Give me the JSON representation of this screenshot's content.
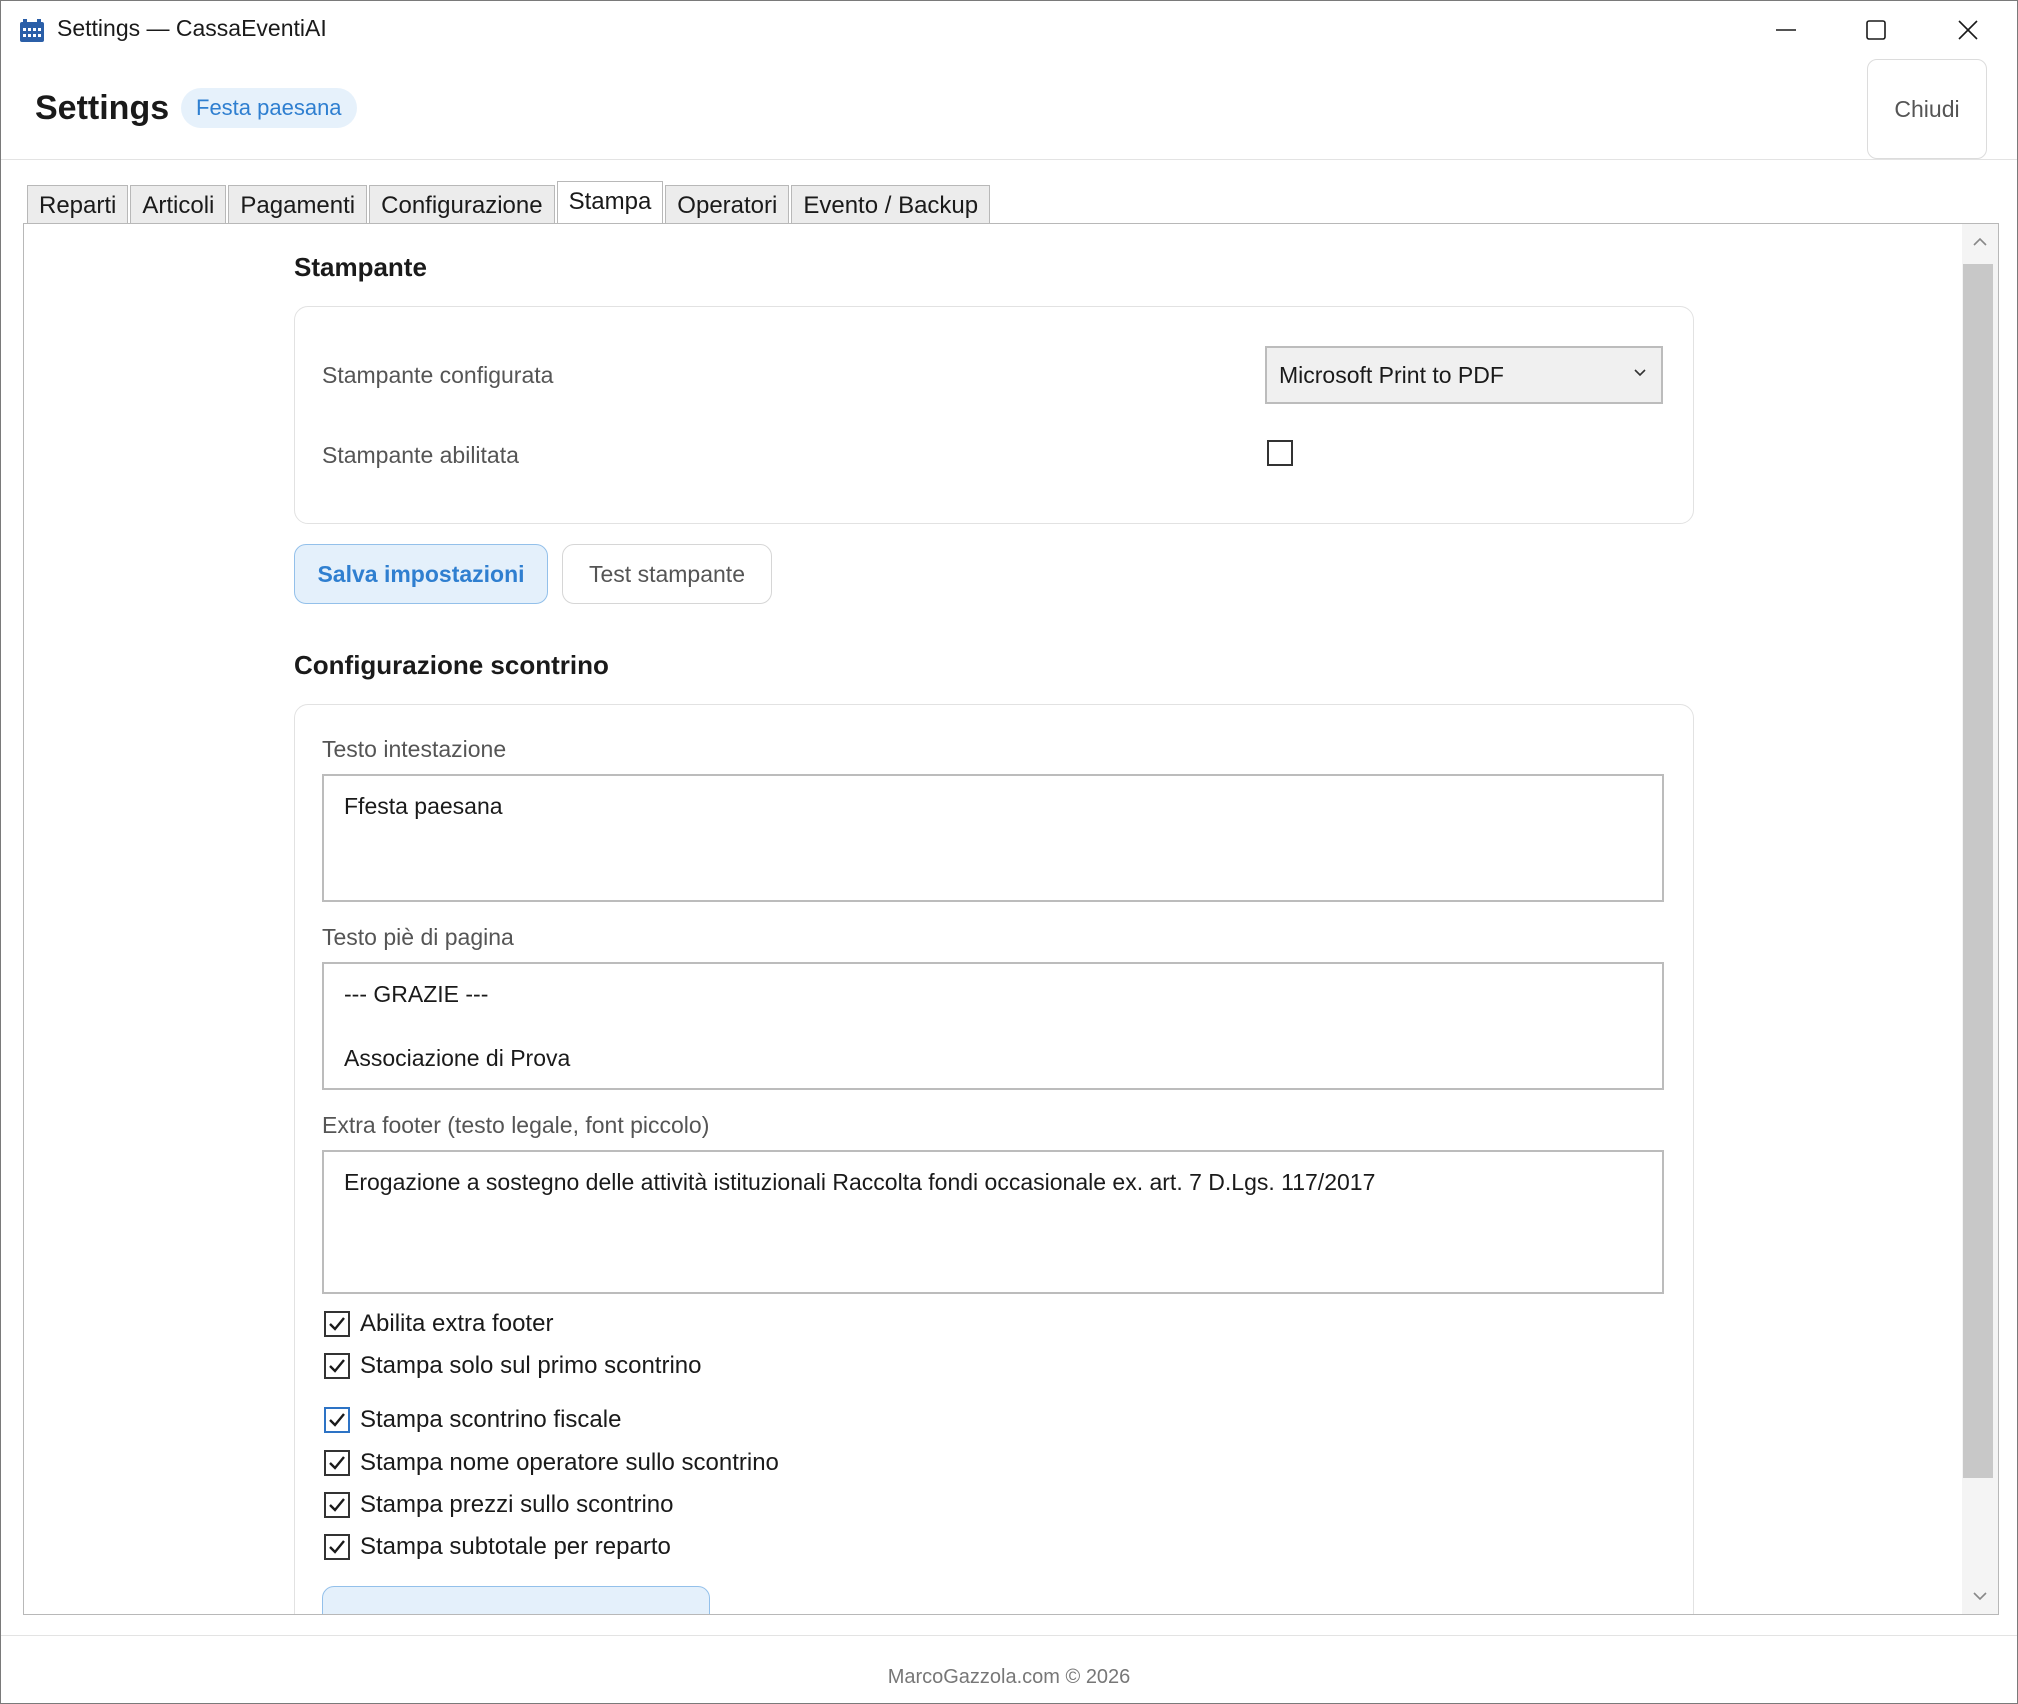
{
  "window": {
    "title": "Settings — CassaEventiAI"
  },
  "header": {
    "title": "Settings",
    "event_badge": "Festa paesana",
    "close_label": "Chiudi"
  },
  "tabs": [
    {
      "label": "Reparti",
      "active": false
    },
    {
      "label": "Articoli",
      "active": false
    },
    {
      "label": "Pagamenti",
      "active": false
    },
    {
      "label": "Configurazione",
      "active": false
    },
    {
      "label": "Stampa",
      "active": true
    },
    {
      "label": "Operatori",
      "active": false
    },
    {
      "label": "Evento / Backup",
      "active": false
    }
  ],
  "printer": {
    "section_title": "Stampante",
    "configured_label": "Stampante configurata",
    "configured_value": "Microsoft Print to PDF",
    "enabled_label": "Stampante abilitata",
    "enabled": false,
    "save_label": "Salva impostazioni",
    "test_label": "Test stampante"
  },
  "receipt": {
    "section_title": "Configurazione scontrino",
    "header_label": "Testo intestazione",
    "header_value": "Ffesta paesana",
    "footer_label": "Testo piè di pagina",
    "footer_value": "---  GRAZIE  ---\n\nAssociazione di Prova",
    "extra_label": "Extra footer (testo legale, font piccolo)",
    "extra_value": "Erogazione a sostegno delle attività istituzionali Raccolta fondi occasionale ex. art. 7 D.Lgs. 117/2017",
    "options": [
      {
        "label": "Abilita extra footer",
        "checked": true
      },
      {
        "label": "Stampa solo sul primo scontrino",
        "checked": true
      },
      {
        "label": "Stampa scontrino fiscale",
        "checked": true
      },
      {
        "label": "Stampa nome operatore sullo scontrino",
        "checked": true
      },
      {
        "label": "Stampa prezzi sullo scontrino",
        "checked": true
      },
      {
        "label": "Stampa subtotale per reparto",
        "checked": true
      }
    ]
  },
  "footer": {
    "text": "MarcoGazzola.com © 2026"
  },
  "colors": {
    "accent": "#2f7fd0",
    "accent_bg": "#e4f0fb"
  }
}
